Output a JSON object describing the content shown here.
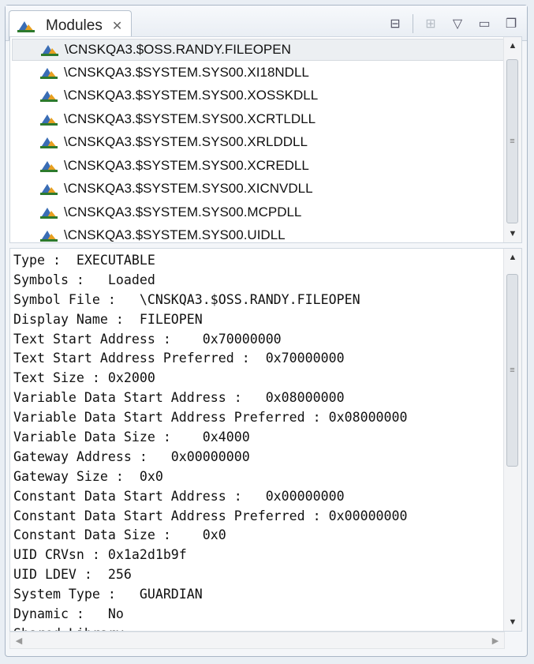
{
  "tab": {
    "title": "Modules",
    "close_glyph": "✕"
  },
  "toolbar": {
    "collapse_glyph": "⊟",
    "pin_glyph": "⊞",
    "menu_glyph": "▽",
    "minimize_glyph": "▭",
    "restore_glyph": "❐"
  },
  "modules": [
    "\\CNSKQA3.$OSS.RANDY.FILEOPEN",
    "\\CNSKQA3.$SYSTEM.SYS00.XI18NDLL",
    "\\CNSKQA3.$SYSTEM.SYS00.XOSSKDLL",
    "\\CNSKQA3.$SYSTEM.SYS00.XCRTLDLL",
    "\\CNSKQA3.$SYSTEM.SYS00.XRLDDLL",
    "\\CNSKQA3.$SYSTEM.SYS00.XCREDLL",
    "\\CNSKQA3.$SYSTEM.SYS00.XICNVDLL",
    "\\CNSKQA3.$SYSTEM.SYS00.MCPDLL",
    "\\CNSKQA3.$SYSTEM.SYS00.UIDLL"
  ],
  "details": [
    "Type :  EXECUTABLE",
    "Symbols :   Loaded",
    "Symbol File :   \\CNSKQA3.$OSS.RANDY.FILEOPEN",
    "Display Name :  FILEOPEN",
    "Text Start Address :    0x70000000",
    "Text Start Address Preferred :  0x70000000",
    "Text Size : 0x2000",
    "Variable Data Start Address :   0x08000000",
    "Variable Data Start Address Preferred : 0x08000000",
    "Variable Data Size :    0x4000",
    "Gateway Address :   0x00000000",
    "Gateway Size :  0x0",
    "Constant Data Start Address :   0x00000000",
    "Constant Data Start Address Preferred : 0x00000000",
    "Constant Data Size :    0x0",
    "UID CRVsn : 0x1a2d1b9f",
    "UID LDEV :  256",
    "System Type :   GUARDIAN",
    "Dynamic :   No",
    "Shared Library :"
  ]
}
